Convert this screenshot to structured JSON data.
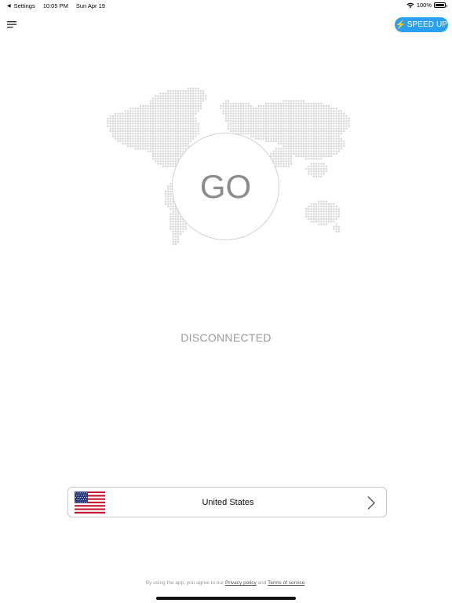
{
  "status_bar": {
    "back_label": "Settings",
    "time": "10:05 PM",
    "date": "Sun Apr 19",
    "battery": "100%",
    "battery_level": 1.0,
    "icons": [
      "back-arrow-icon",
      "wifi-icon",
      "battery-icon"
    ]
  },
  "header": {
    "menu_icon": "hamburger-menu-icon",
    "speed_button": {
      "icon": "lightning-icon",
      "label": "SPEED UP",
      "color": "#2b9ff0",
      "icon_color": "#f7d21e"
    }
  },
  "main": {
    "map_icon": "world-map-dots",
    "go_label": "GO",
    "connection_status": "DISCONNECTED"
  },
  "country_selector": {
    "flag_icon": "us-flag-icon",
    "country": "United States",
    "chevron_icon": "chevron-right-icon"
  },
  "footer": {
    "prefix": "By using the app, you agree to our",
    "privacy_link": "Privacy policy",
    "and": "and",
    "terms_link": "Terms of service",
    "suffix": "."
  },
  "colors": {
    "accent": "#2b9ff0",
    "map_dots": "#d4d4d4",
    "muted_text": "#9b9b9b",
    "flag_red": "#c8102e",
    "flag_blue": "#2a3a7c"
  }
}
